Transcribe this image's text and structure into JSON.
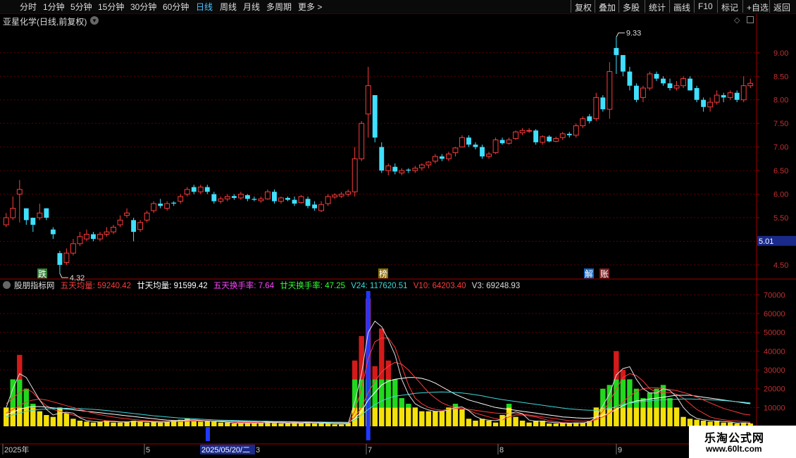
{
  "toolbar": {
    "periods": [
      "分时",
      "1分钟",
      "5分钟",
      "15分钟",
      "30分钟",
      "60分钟",
      "日线",
      "周线",
      "月线",
      "多周期",
      "更多"
    ],
    "active": "日线",
    "right_buttons": [
      "复权",
      "叠加",
      "多股",
      "统计",
      "画线",
      "F10",
      "+自选",
      "返回"
    ],
    "more_arrow": ">",
    "mark_label": "标记"
  },
  "stock": {
    "title": "亚星化学(日线,前复权)"
  },
  "price_axis": {
    "labels": [
      "9.00",
      "8.50",
      "8.00",
      "7.50",
      "7.00",
      "6.50",
      "6.00",
      "5.50",
      "5.00",
      "4.50"
    ],
    "current": "5.01"
  },
  "annotations": {
    "high": "9.33",
    "low": "4.32"
  },
  "badges": [
    {
      "text": "跌",
      "color": "#2e7d32"
    },
    {
      "text": "榜",
      "color": "#8d6e00"
    },
    {
      "text": "解",
      "color": "#1565c0"
    },
    {
      "text": "账",
      "color": "#7b1f1f"
    }
  ],
  "indicator": {
    "name": "股朋指标网",
    "items": [
      {
        "label": "五天均量: 59240.42",
        "color": "#ff3b3b"
      },
      {
        "label": "廿天均量: 91599.42",
        "color": "#ffffff"
      },
      {
        "label": "五天换手率: 7.64",
        "color": "#ff44ff"
      },
      {
        "label": "廿天换手率: 47.25",
        "color": "#33ff33"
      },
      {
        "label": "V24: 117620.51",
        "color": "#3fd8d8"
      },
      {
        "label": "V10: 64203.40",
        "color": "#ff3b3b"
      },
      {
        "label": "V3: 69248.93",
        "color": "#dddddd"
      }
    ],
    "axis_labels": [
      "70000",
      "60000",
      "50000",
      "40000",
      "30000",
      "20000",
      "10000"
    ]
  },
  "date_axis": {
    "labels": [
      "2025年",
      "5",
      "7",
      "8",
      "9"
    ],
    "cursor": "2025/05/20/二",
    "cursor_tail": "3"
  },
  "watermark": {
    "title": "乐淘公式网",
    "url": "www.60lt.com"
  },
  "colors": {
    "up": "#ff3b3b",
    "down": "#3fe0ff",
    "grid": "#5a0000",
    "axis": "#a00000"
  },
  "chart_data": {
    "type": "candlestick",
    "y_range": [
      4.2,
      9.55
    ],
    "closes": [
      5.5,
      5.7,
      6.1,
      5.45,
      5.35,
      5.6,
      5.5,
      5.15,
      4.5,
      4.75,
      4.95,
      5.1,
      5.15,
      5.05,
      5.15,
      5.2,
      5.3,
      5.45,
      5.6,
      5.2,
      5.4,
      5.6,
      5.8,
      5.75,
      5.8,
      5.8,
      5.95,
      6.1,
      6.05,
      6.15,
      6.05,
      5.85,
      5.9,
      5.95,
      5.92,
      6.0,
      5.9,
      5.88,
      5.9,
      6.05,
      5.85,
      5.92,
      5.88,
      5.8,
      5.95,
      5.75,
      5.7,
      5.78,
      5.95,
      5.98,
      6.0,
      6.05,
      6.75,
      7.5,
      8.3,
      7.2,
      6.5,
      6.6,
      6.48,
      6.5,
      6.5,
      6.55,
      6.62,
      6.68,
      6.8,
      6.75,
      6.85,
      6.98,
      7.2,
      7.05,
      7.0,
      6.8,
      6.85,
      7.15,
      7.08,
      7.15,
      7.32,
      7.35,
      7.35,
      7.1,
      7.22,
      7.12,
      7.18,
      7.28,
      7.25,
      7.45,
      7.6,
      7.55,
      8.05,
      7.8,
      8.6,
      8.95,
      8.6,
      8.3,
      8.0,
      8.25,
      8.55,
      8.45,
      8.35,
      8.25,
      8.3,
      8.45,
      8.2,
      8.0,
      7.85,
      7.95,
      8.1,
      8.05,
      8.15,
      8.0,
      8.3,
      8.35
    ],
    "opens": [
      5.35,
      5.5,
      6.0,
      5.7,
      5.5,
      5.5,
      5.7,
      5.25,
      4.75,
      4.55,
      4.75,
      4.95,
      5.05,
      5.15,
      5.05,
      5.15,
      5.2,
      5.35,
      5.55,
      5.45,
      5.25,
      5.45,
      5.65,
      5.8,
      5.7,
      5.82,
      5.85,
      6.0,
      6.15,
      6.05,
      6.15,
      6.0,
      5.85,
      5.9,
      5.96,
      5.92,
      5.98,
      5.9,
      5.86,
      5.9,
      6.05,
      5.85,
      5.92,
      5.88,
      5.82,
      5.9,
      5.78,
      5.65,
      5.8,
      5.94,
      5.96,
      6.0,
      6.05,
      6.75,
      7.7,
      8.1,
      7.0,
      6.5,
      6.58,
      6.45,
      6.52,
      6.5,
      6.56,
      6.62,
      6.7,
      6.8,
      6.75,
      6.88,
      7.0,
      7.2,
      7.05,
      7.0,
      6.8,
      6.88,
      7.15,
      7.08,
      7.18,
      7.3,
      7.35,
      7.35,
      7.1,
      7.22,
      7.12,
      7.2,
      7.28,
      7.25,
      7.45,
      7.65,
      7.6,
      8.05,
      7.8,
      9.1,
      8.95,
      8.6,
      8.3,
      8.05,
      8.25,
      8.55,
      8.45,
      8.35,
      8.25,
      8.3,
      8.45,
      8.25,
      8.0,
      7.85,
      7.95,
      8.1,
      8.05,
      8.15,
      8.0,
      8.3
    ],
    "highs": [
      5.6,
      5.95,
      6.3,
      5.7,
      5.5,
      5.8,
      5.7,
      5.3,
      4.8,
      4.85,
      5.05,
      5.2,
      5.25,
      5.2,
      5.2,
      5.3,
      5.35,
      5.55,
      5.7,
      5.5,
      5.45,
      5.65,
      5.85,
      5.9,
      5.85,
      5.85,
      6.0,
      6.15,
      6.2,
      6.2,
      6.2,
      6.05,
      5.95,
      6.0,
      6.0,
      6.05,
      6.0,
      5.95,
      5.95,
      6.1,
      6.1,
      5.95,
      5.95,
      5.95,
      5.98,
      5.95,
      5.85,
      5.85,
      6.0,
      6.02,
      6.05,
      6.1,
      7.0,
      7.55,
      8.7,
      8.1,
      7.1,
      6.65,
      6.65,
      6.55,
      6.55,
      6.6,
      6.65,
      6.7,
      6.85,
      6.85,
      6.9,
      7.0,
      7.25,
      7.25,
      7.1,
      7.05,
      6.9,
      7.2,
      7.2,
      7.2,
      7.35,
      7.4,
      7.4,
      7.38,
      7.25,
      7.25,
      7.22,
      7.32,
      7.32,
      7.5,
      7.65,
      7.7,
      8.15,
      8.1,
      8.8,
      9.33,
      8.95,
      8.7,
      8.35,
      8.3,
      8.6,
      8.6,
      8.5,
      8.45,
      8.4,
      8.5,
      8.5,
      8.3,
      8.05,
      8.05,
      8.2,
      8.15,
      8.2,
      8.2,
      8.5,
      8.45
    ],
    "lows": [
      5.3,
      5.45,
      5.4,
      5.35,
      5.2,
      5.45,
      5.45,
      5.05,
      4.32,
      4.5,
      4.7,
      4.9,
      5.0,
      5.0,
      5.0,
      5.1,
      5.15,
      5.3,
      5.5,
      5.0,
      5.2,
      5.4,
      5.6,
      5.7,
      5.65,
      5.75,
      5.8,
      5.95,
      6.0,
      6.0,
      6.0,
      5.8,
      5.8,
      5.85,
      5.88,
      5.88,
      5.85,
      5.85,
      5.82,
      5.88,
      5.8,
      5.8,
      5.85,
      5.75,
      5.8,
      5.7,
      5.65,
      5.62,
      5.75,
      5.9,
      5.92,
      5.95,
      5.95,
      6.7,
      7.2,
      7.1,
      6.45,
      6.4,
      6.42,
      6.4,
      6.45,
      6.45,
      6.5,
      6.55,
      6.65,
      6.7,
      6.7,
      6.8,
      7.0,
      7.0,
      6.95,
      6.75,
      6.75,
      6.85,
      7.05,
      7.05,
      7.15,
      7.25,
      7.3,
      7.05,
      7.05,
      7.1,
      7.1,
      7.15,
      7.2,
      7.2,
      7.4,
      7.5,
      7.55,
      7.75,
      7.6,
      8.55,
      8.5,
      8.2,
      7.95,
      7.95,
      8.2,
      8.4,
      8.3,
      8.2,
      8.2,
      8.25,
      8.2,
      7.95,
      7.75,
      7.75,
      7.9,
      7.95,
      8.0,
      7.95,
      7.95,
      8.25
    ],
    "volumes": [
      10000,
      25000,
      38000,
      20000,
      12000,
      8000,
      6000,
      5000,
      10000,
      7000,
      4000,
      3000,
      2500,
      2000,
      2500,
      3000,
      2000,
      2000,
      2500,
      3000,
      2500,
      2000,
      2500,
      2000,
      2500,
      3000,
      3500,
      4000,
      3000,
      2500,
      3000,
      2500,
      2000,
      2000,
      1500,
      2000,
      1500,
      1500,
      2000,
      2500,
      2000,
      1500,
      1500,
      2000,
      1500,
      2500,
      2000,
      1500,
      1500,
      1000,
      1000,
      2000,
      35000,
      48000,
      68000,
      32000,
      52000,
      35000,
      25000,
      15000,
      12000,
      10000,
      8000,
      8000,
      8000,
      8000,
      10000,
      12000,
      9000,
      4000,
      3000,
      4000,
      3000,
      2000,
      6000,
      12000,
      5000,
      3000,
      2000,
      3000,
      3000,
      1500,
      1500,
      2000,
      1500,
      2000,
      2000,
      3000,
      10000,
      20000,
      22000,
      40000,
      30000,
      25000,
      20000,
      15000,
      18000,
      20000,
      22000,
      15000,
      10000,
      5000,
      4000,
      3500,
      3000,
      2500,
      3000,
      2000,
      2000,
      1500,
      2000,
      1500
    ],
    "volume_range": [
      0,
      72000
    ],
    "vol_ma_short": [
      12000,
      15000,
      18000,
      20000,
      18000,
      14000,
      11000,
      9000,
      8000,
      7000,
      6000,
      5000,
      4500,
      4000,
      3500,
      3000,
      2800,
      2500,
      2500,
      2600,
      2600,
      2500,
      2500,
      2400,
      2400,
      2500,
      2800,
      3000,
      3100,
      3000,
      2900,
      2800,
      2600,
      2400,
      2200,
      2000,
      1900,
      1800,
      1800,
      1900,
      1900,
      1800,
      1700,
      1700,
      1700,
      1800,
      1800,
      1700,
      1600,
      1500,
      1400,
      1400,
      8000,
      20000,
      36000,
      45000,
      47000,
      47000,
      42000,
      32000,
      22000,
      15000,
      12000,
      10000,
      9000,
      8500,
      9000,
      9500,
      9500,
      8500,
      7000,
      6000,
      5000,
      4000,
      3500,
      5000,
      6000,
      6000,
      5500,
      5000,
      4000,
      3000,
      2500,
      2000,
      1800,
      1700,
      1800,
      2200,
      4000,
      8000,
      13000,
      20000,
      26000,
      28000,
      27000,
      24000,
      20000,
      18000,
      18000,
      18000,
      17000,
      15000,
      12000,
      9000,
      7000,
      5000,
      4000,
      3500,
      3000,
      2800,
      2500,
      2200
    ],
    "vol_ma_long": [
      6000,
      7500,
      9000,
      10000,
      10500,
      10500,
      10200,
      9800,
      9500,
      9200,
      8800,
      8400,
      8000,
      7600,
      7200,
      6800,
      6400,
      6000,
      5600,
      5200,
      4800,
      4400,
      4000,
      3600,
      3300,
      3100,
      3000,
      2900,
      2900,
      2900,
      2900,
      2800,
      2800,
      2700,
      2700,
      2600,
      2600,
      2500,
      2500,
      2400,
      2400,
      2300,
      2300,
      2200,
      2200,
      2200,
      2100,
      2100,
      2000,
      2000,
      1900,
      1900,
      4000,
      8000,
      14000,
      18000,
      22000,
      24000,
      25000,
      25500,
      26000,
      26000,
      25500,
      24500,
      23000,
      21000,
      19000,
      17000,
      15500,
      14000,
      13000,
      12000,
      11000,
      10000,
      9500,
      9000,
      8500,
      8000,
      7500,
      7000,
      6500,
      6000,
      5500,
      5000,
      4800,
      4500,
      4300,
      4300,
      4800,
      5800,
      7000,
      9000,
      11000,
      12500,
      13500,
      14000,
      14500,
      15000,
      15500,
      16000,
      16500,
      16500,
      16500,
      16000,
      15500,
      15000,
      14500,
      14000,
      13500,
      13000,
      12500,
      12000
    ],
    "v24": [
      5000,
      6000,
      7000,
      8000,
      8500,
      9000,
      9200,
      9400,
      9500,
      9600,
      9500,
      9400,
      9200,
      9000,
      8700,
      8400,
      8000,
      7600,
      7200,
      6800,
      6400,
      6000,
      5600,
      5300,
      5000,
      4700,
      4400,
      4200,
      4000,
      3800,
      3600,
      3400,
      3300,
      3200,
      3100,
      3000,
      2900,
      2800,
      2700,
      2700,
      2600,
      2600,
      2500,
      2500,
      2400,
      2400,
      2300,
      2300,
      2200,
      2200,
      2200,
      2100,
      3500,
      6000,
      9000,
      11500,
      13500,
      15000,
      16000,
      16500,
      17000,
      17500,
      17800,
      18000,
      18200,
      18300,
      18200,
      18000,
      17700,
      17300,
      16800,
      16200,
      15500,
      14800,
      14200,
      13700,
      13200,
      12700,
      12200,
      11700,
      11200,
      10700,
      10200,
      9700,
      9300,
      9000,
      8700,
      8500,
      8600,
      9000,
      9500,
      10500,
      11500,
      12300,
      12900,
      13300,
      13600,
      13900,
      14100,
      14300,
      14400,
      14500,
      14500,
      14400,
      14300,
      14100,
      13900,
      13700,
      13400,
      13100,
      12800,
      12500
    ],
    "v10": [
      7000,
      9000,
      11000,
      13000,
      14000,
      14500,
      14000,
      13000,
      12000,
      11000,
      10000,
      9000,
      8000,
      7000,
      6200,
      5500,
      4900,
      4400,
      4000,
      3600,
      3300,
      3000,
      2800,
      2700,
      2600,
      2600,
      2600,
      2700,
      2800,
      2800,
      2800,
      2700,
      2600,
      2500,
      2400,
      2300,
      2200,
      2100,
      2000,
      2000,
      1900,
      1900,
      1800,
      1800,
      1800,
      1800,
      1700,
      1700,
      1700,
      1600,
      1600,
      1600,
      5000,
      10000,
      18000,
      24000,
      29000,
      32000,
      34000,
      33000,
      30000,
      26000,
      22000,
      18000,
      15000,
      12500,
      11000,
      10000,
      9500,
      9000,
      8500,
      8000,
      7500,
      7000,
      6800,
      6800,
      6800,
      6500,
      6000,
      5500,
      5000,
      4500,
      4000,
      3500,
      3000,
      2800,
      2700,
      2800,
      3500,
      5000,
      7000,
      10000,
      13000,
      16000,
      18500,
      20000,
      20500,
      20500,
      20000,
      19500,
      19000,
      18000,
      17000,
      15500,
      14000,
      12500,
      11000,
      9500,
      8500,
      7500,
      6500,
      6000
    ],
    "v3": [
      10000,
      20000,
      28000,
      26000,
      20000,
      14000,
      9000,
      6000,
      7000,
      7500,
      7000,
      4500,
      3000,
      2500,
      2300,
      2500,
      2500,
      2300,
      2200,
      2500,
      2600,
      2500,
      2300,
      2200,
      2300,
      2500,
      3000,
      3500,
      3500,
      3200,
      2800,
      2700,
      2500,
      2200,
      1800,
      1700,
      1700,
      1700,
      1800,
      2000,
      2100,
      1900,
      1700,
      1600,
      1700,
      2000,
      2000,
      1700,
      1700,
      1300,
      1200,
      1400,
      13000,
      28000,
      50000,
      56000,
      53000,
      46000,
      38000,
      25000,
      17000,
      12000,
      10000,
      8700,
      8000,
      8000,
      8700,
      10000,
      10300,
      8300,
      5300,
      3700,
      3300,
      3000,
      3700,
      6700,
      7700,
      6700,
      3300,
      2700,
      2700,
      2200,
      2000,
      1700,
      1700,
      1800,
      1800,
      2300,
      5000,
      11000,
      17300,
      27300,
      30700,
      31700,
      25000,
      20000,
      17700,
      17700,
      20000,
      19000,
      15700,
      10000,
      6300,
      4200,
      3500,
      3000,
      2800,
      2500,
      2300,
      1800,
      1800,
      1700
    ]
  }
}
